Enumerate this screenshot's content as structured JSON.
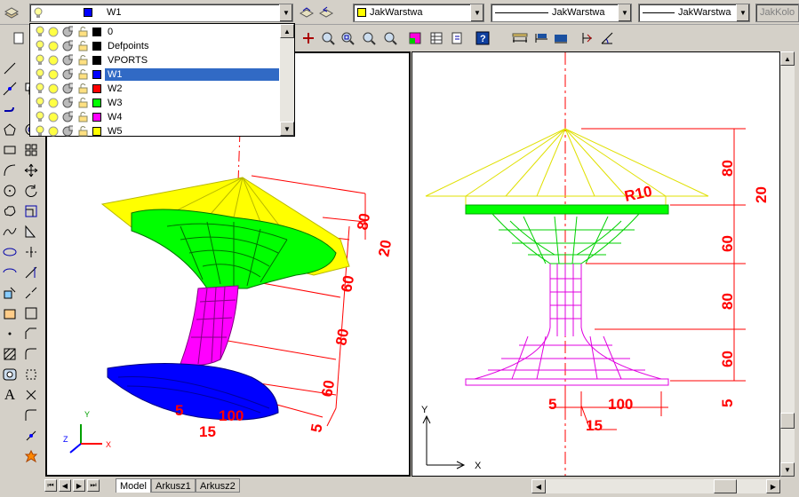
{
  "toolbar": {
    "layer_current": "W1",
    "color_value": "JakWarstwa",
    "linetype_value": "JakWarstwa",
    "lineweight_value": "JakWarstwa",
    "plotstyle_value": "JakKolo"
  },
  "layers": [
    {
      "name": "0",
      "color": "#000000"
    },
    {
      "name": "Defpoints",
      "color": "#000000"
    },
    {
      "name": "VPORTS",
      "color": "#000000"
    },
    {
      "name": "W1",
      "color": "#0000ff",
      "selected": true
    },
    {
      "name": "W2",
      "color": "#ff0000"
    },
    {
      "name": "W3",
      "color": "#00ff00"
    },
    {
      "name": "W4",
      "color": "#ff00ff"
    },
    {
      "name": "W5",
      "color": "#ffff00"
    }
  ],
  "tabs": [
    "Model",
    "Arkusz1",
    "Arkusz2"
  ],
  "viewport_left": {
    "dims": [
      "80",
      "20",
      "60",
      "80",
      "60",
      "5",
      "100",
      "15",
      "5"
    ],
    "ucs": {
      "x": "X",
      "y": "Y",
      "z": "Z"
    }
  },
  "viewport_right": {
    "dims": [
      "80",
      "20",
      "60",
      "80",
      "60",
      "5",
      "R10",
      "5",
      "100",
      "15"
    ],
    "ucs": {
      "x": "X",
      "y": "Y"
    }
  },
  "colors": {
    "dim": "#ff0000",
    "w1": "#0000ff",
    "w3": "#00ff00",
    "w4": "#ff00ff",
    "w5": "#ffff00"
  }
}
